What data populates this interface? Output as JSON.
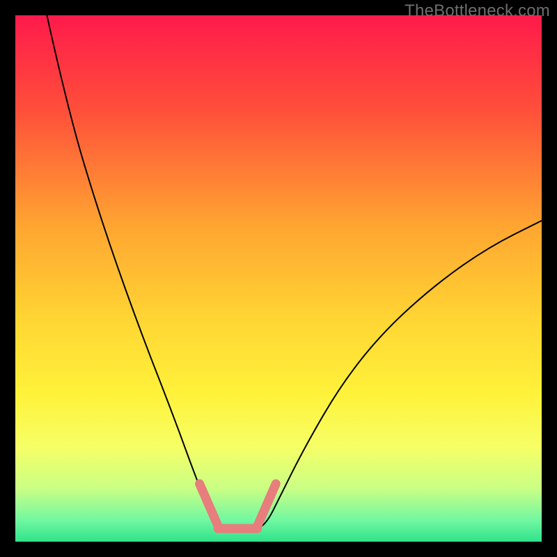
{
  "watermark": "TheBottleneck.com",
  "chart_data": {
    "type": "line",
    "title": "",
    "xlabel": "",
    "ylabel": "",
    "xlim": [
      0,
      100
    ],
    "ylim": [
      0,
      100
    ],
    "grid": false,
    "legend": false,
    "gradient_stops": [
      {
        "offset": 0.0,
        "color": "#ff1a4b"
      },
      {
        "offset": 0.18,
        "color": "#ff4f3a"
      },
      {
        "offset": 0.4,
        "color": "#ffa531"
      },
      {
        "offset": 0.58,
        "color": "#ffd633"
      },
      {
        "offset": 0.72,
        "color": "#fff23a"
      },
      {
        "offset": 0.82,
        "color": "#f6ff66"
      },
      {
        "offset": 0.9,
        "color": "#c9ff85"
      },
      {
        "offset": 0.96,
        "color": "#70f7a1"
      },
      {
        "offset": 1.0,
        "color": "#2fe38b"
      }
    ],
    "series": [
      {
        "name": "bottleneck-curve",
        "color": "#000000",
        "stroke_width": 2,
        "points": [
          {
            "x": 6.0,
            "y": 100.0
          },
          {
            "x": 10.0,
            "y": 82.0
          },
          {
            "x": 16.0,
            "y": 62.0
          },
          {
            "x": 23.0,
            "y": 42.0
          },
          {
            "x": 30.0,
            "y": 24.0
          },
          {
            "x": 34.0,
            "y": 13.0
          },
          {
            "x": 36.0,
            "y": 8.0
          },
          {
            "x": 38.0,
            "y": 3.5
          },
          {
            "x": 40.0,
            "y": 2.0
          },
          {
            "x": 43.0,
            "y": 1.8
          },
          {
            "x": 46.0,
            "y": 2.2
          },
          {
            "x": 48.0,
            "y": 4.0
          },
          {
            "x": 50.0,
            "y": 8.0
          },
          {
            "x": 55.0,
            "y": 18.0
          },
          {
            "x": 62.0,
            "y": 30.0
          },
          {
            "x": 70.0,
            "y": 40.0
          },
          {
            "x": 80.0,
            "y": 49.0
          },
          {
            "x": 90.0,
            "y": 56.0
          },
          {
            "x": 100.0,
            "y": 61.0
          }
        ]
      },
      {
        "name": "highlighted-range",
        "color": "#e77d7d",
        "stroke_width": 13,
        "segments": [
          {
            "from": {
              "x": 35.0,
              "y": 11.0
            },
            "to": {
              "x": 38.5,
              "y": 3.0
            }
          },
          {
            "from": {
              "x": 38.5,
              "y": 2.5
            },
            "to": {
              "x": 46.0,
              "y": 2.5
            }
          },
          {
            "from": {
              "x": 46.0,
              "y": 3.0
            },
            "to": {
              "x": 49.5,
              "y": 11.0
            }
          }
        ]
      }
    ]
  }
}
